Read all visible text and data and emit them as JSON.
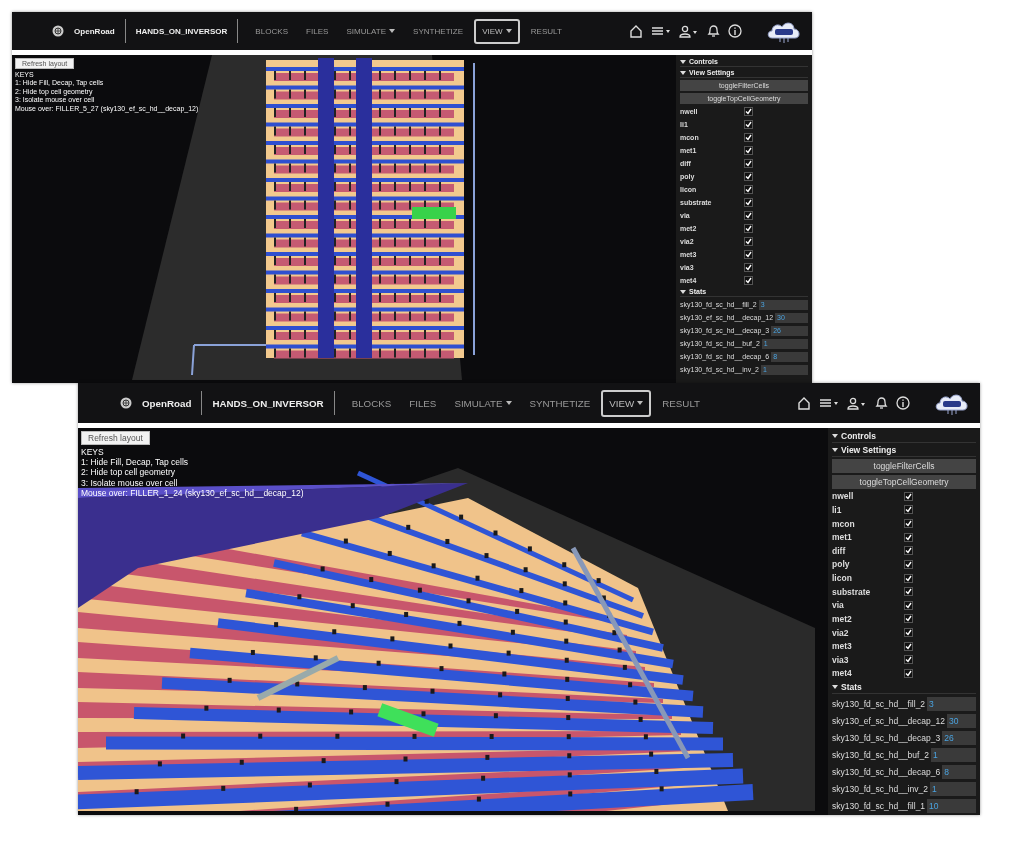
{
  "windows": [
    {
      "navbar": {
        "app": "OpenRoad",
        "project": "HANDS_ON_INVERSOR",
        "menu": [
          {
            "label": "BLOCKS",
            "dropdown": false,
            "selected": false
          },
          {
            "label": "FILES",
            "dropdown": false,
            "selected": false
          },
          {
            "label": "SIMULATE",
            "dropdown": true,
            "selected": false
          },
          {
            "label": "SYNTHETIZE",
            "dropdown": false,
            "selected": false
          },
          {
            "label": "VIEW",
            "dropdown": true,
            "selected": true
          },
          {
            "label": "RESULT",
            "dropdown": false,
            "selected": false
          }
        ]
      },
      "viewport": {
        "button": "Refresh layout",
        "keys": [
          "KEYS",
          "1: Hide Fill, Decap, Tap cells",
          "2: Hide top cell geometry",
          "3: Isolate mouse over cell",
          "Mouse over: FILLER_5_27 (sky130_ef_sc_hd__decap_12)"
        ]
      },
      "panel": {
        "controls": {
          "label": "Controls",
          "expanded": true
        },
        "view_settings": {
          "label": "View Settings",
          "expanded": true
        },
        "toggles": [
          "toggleFilterCells",
          "toggleTopCellGeometry"
        ],
        "layers": [
          {
            "name": "nwell",
            "checked": true
          },
          {
            "name": "li1",
            "checked": true
          },
          {
            "name": "mcon",
            "checked": true
          },
          {
            "name": "met1",
            "checked": true
          },
          {
            "name": "diff",
            "checked": true
          },
          {
            "name": "poly",
            "checked": true
          },
          {
            "name": "licon",
            "checked": true
          },
          {
            "name": "substrate",
            "checked": true
          },
          {
            "name": "via",
            "checked": true
          },
          {
            "name": "met2",
            "checked": true
          },
          {
            "name": "via2",
            "checked": true
          },
          {
            "name": "met3",
            "checked": true
          },
          {
            "name": "via3",
            "checked": true
          },
          {
            "name": "met4",
            "checked": true
          }
        ],
        "stats_section": {
          "label": "Stats",
          "expanded": true
        },
        "stats": [
          {
            "name": "sky130_fd_sc_hd__fill_2",
            "value": "3"
          },
          {
            "name": "sky130_ef_sc_hd__decap_12",
            "value": "30"
          },
          {
            "name": "sky130_fd_sc_hd__decap_3",
            "value": "26"
          },
          {
            "name": "sky130_fd_sc_hd__buf_2",
            "value": "1"
          },
          {
            "name": "sky130_fd_sc_hd__decap_6",
            "value": "8"
          },
          {
            "name": "sky130_fd_sc_hd__inv_2",
            "value": "1"
          }
        ]
      }
    },
    {
      "navbar": {
        "app": "OpenRoad",
        "project": "HANDS_ON_INVERSOR",
        "menu": [
          {
            "label": "BLOCKS",
            "dropdown": false,
            "selected": false
          },
          {
            "label": "FILES",
            "dropdown": false,
            "selected": false
          },
          {
            "label": "SIMULATE",
            "dropdown": true,
            "selected": false
          },
          {
            "label": "SYNTHETIZE",
            "dropdown": false,
            "selected": false
          },
          {
            "label": "VIEW",
            "dropdown": true,
            "selected": true
          },
          {
            "label": "RESULT",
            "dropdown": false,
            "selected": false
          }
        ]
      },
      "viewport": {
        "button": "Refresh layout",
        "keys": [
          "KEYS",
          "1: Hide Fill, Decap, Tap cells",
          "2: Hide top cell geometry",
          "3: Isolate mouse over cell",
          "Mouse over: FILLER_1_24 (sky130_ef_sc_hd__decap_12)"
        ]
      },
      "panel": {
        "controls": {
          "label": "Controls",
          "expanded": true
        },
        "view_settings": {
          "label": "View Settings",
          "expanded": true
        },
        "toggles": [
          "toggleFilterCells",
          "toggleTopCellGeometry"
        ],
        "layers": [
          {
            "name": "nwell",
            "checked": true
          },
          {
            "name": "li1",
            "checked": true
          },
          {
            "name": "mcon",
            "checked": true
          },
          {
            "name": "met1",
            "checked": true
          },
          {
            "name": "diff",
            "checked": true
          },
          {
            "name": "poly",
            "checked": true
          },
          {
            "name": "licon",
            "checked": true
          },
          {
            "name": "substrate",
            "checked": true
          },
          {
            "name": "via",
            "checked": true
          },
          {
            "name": "met2",
            "checked": true
          },
          {
            "name": "via2",
            "checked": true
          },
          {
            "name": "met3",
            "checked": true
          },
          {
            "name": "via3",
            "checked": true
          },
          {
            "name": "met4",
            "checked": true
          }
        ],
        "stats_section": {
          "label": "Stats",
          "expanded": true
        },
        "stats": [
          {
            "name": "sky130_fd_sc_hd__fill_2",
            "value": "3"
          },
          {
            "name": "sky130_ef_sc_hd__decap_12",
            "value": "30"
          },
          {
            "name": "sky130_fd_sc_hd__decap_3",
            "value": "26"
          },
          {
            "name": "sky130_fd_sc_hd__buf_2",
            "value": "1"
          },
          {
            "name": "sky130_fd_sc_hd__decap_6",
            "value": "8"
          },
          {
            "name": "sky130_fd_sc_hd__inv_2",
            "value": "1"
          },
          {
            "name": "sky130_fd_sc_hd__fill_1",
            "value": "10"
          }
        ]
      }
    }
  ]
}
